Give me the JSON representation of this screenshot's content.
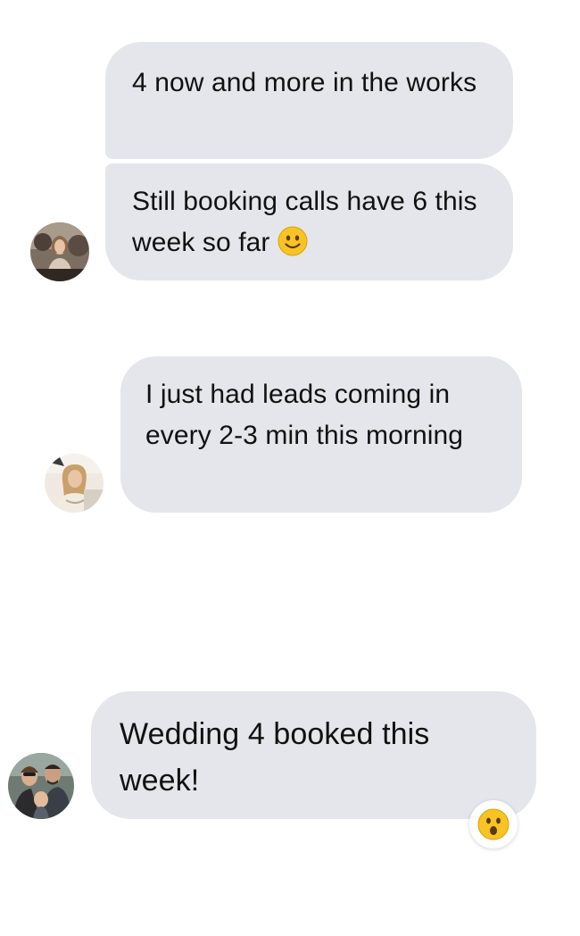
{
  "messages": [
    {
      "text": "4 now and more in the works"
    },
    {
      "text": "Still booking calls have 6 this week so far",
      "emoji": "slightly-smiling-face-emoji"
    },
    {
      "text": "I just had leads coming in every 2-3 min this morning"
    },
    {
      "text": "Wedding 4 booked this week!",
      "reaction": "astonished-face-emoji"
    }
  ],
  "colors": {
    "bubble": "#e4e6eb",
    "text": "#111111",
    "emoji_yellow": "#f7c325"
  }
}
